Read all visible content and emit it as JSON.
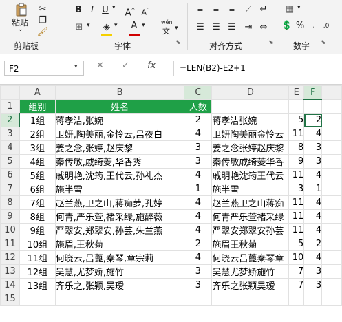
{
  "ribbon": {
    "paste_label": "粘贴",
    "group_clipboard": "剪贴板",
    "group_font": "字体",
    "group_alignment": "对齐方式",
    "group_number": "数字",
    "bold": "B",
    "italic": "I",
    "underline": "U",
    "font_color": "A",
    "wen": "wén",
    "wen_sub": "文",
    "percent": "%"
  },
  "formula_bar": {
    "name_box": "F2",
    "fx": "fx",
    "formula": "=LEN(B2)-E2+1"
  },
  "columns": [
    "A",
    "B",
    "C",
    "D",
    "E",
    "F"
  ],
  "rows": [
    "1",
    "2",
    "3",
    "4",
    "5",
    "6",
    "7",
    "8",
    "9",
    "10",
    "11",
    "12",
    "13",
    "14",
    "15"
  ],
  "header": {
    "a": "组别",
    "b": "姓名",
    "c": "人数"
  },
  "data": [
    {
      "a": "1组",
      "b": "蒋孝洁,张婉",
      "c": "2",
      "d": "蒋孝洁张婉",
      "e": "5",
      "f": "2"
    },
    {
      "a": "2组",
      "b": "卫妍,陶美丽,金怜云,吕夜白",
      "c": "4",
      "d": "卫妍陶美丽金怜云",
      "e": "11",
      "f": "4"
    },
    {
      "a": "3组",
      "b": "姜之念,张婷,赵庆黎",
      "c": "3",
      "d": "姜之念张婷赵庆黎",
      "e": "8",
      "f": "3"
    },
    {
      "a": "4组",
      "b": "秦传敏,戚绮菱,华香秀",
      "c": "3",
      "d": "秦传敏戚绮菱华香",
      "e": "9",
      "f": "3"
    },
    {
      "a": "5组",
      "b": "戚明艳,沈筠,王代云,孙礼杰",
      "c": "4",
      "d": "戚明艳沈筠王代云",
      "e": "11",
      "f": "4"
    },
    {
      "a": "6组",
      "b": "施半雪",
      "c": "1",
      "d": "施半雪",
      "e": "3",
      "f": "1"
    },
    {
      "a": "7组",
      "b": "赵兰燕,卫之山,蒋痴萝,孔婷",
      "c": "4",
      "d": "赵兰燕卫之山蒋痴",
      "e": "11",
      "f": "4"
    },
    {
      "a": "8组",
      "b": "何青,严乐萱,褚采绿,施醉薇",
      "c": "4",
      "d": "何青严乐萱褚采绿",
      "e": "11",
      "f": "4"
    },
    {
      "a": "9组",
      "b": "严翠安,郑翠安,孙芸,朱兰燕",
      "c": "4",
      "d": "严翠安郑翠安孙芸",
      "e": "11",
      "f": "4"
    },
    {
      "a": "10组",
      "b": "施眉,王秋菊",
      "c": "2",
      "d": "施眉王秋菊",
      "e": "5",
      "f": "2"
    },
    {
      "a": "11组",
      "b": "何晓云,吕蓖,秦琴,章宗莉",
      "c": "4",
      "d": "何晓云吕蓖秦琴章",
      "e": "10",
      "f": "4"
    },
    {
      "a": "12组",
      "b": "吴慧,尤梦娇,施竹",
      "c": "3",
      "d": "吴慧尤梦娇施竹",
      "e": "7",
      "f": "3"
    },
    {
      "a": "13组",
      "b": "齐乐之,张颖,吴瑷",
      "c": "3",
      "d": "齐乐之张颖吴瑷",
      "e": "7",
      "f": "3"
    }
  ]
}
